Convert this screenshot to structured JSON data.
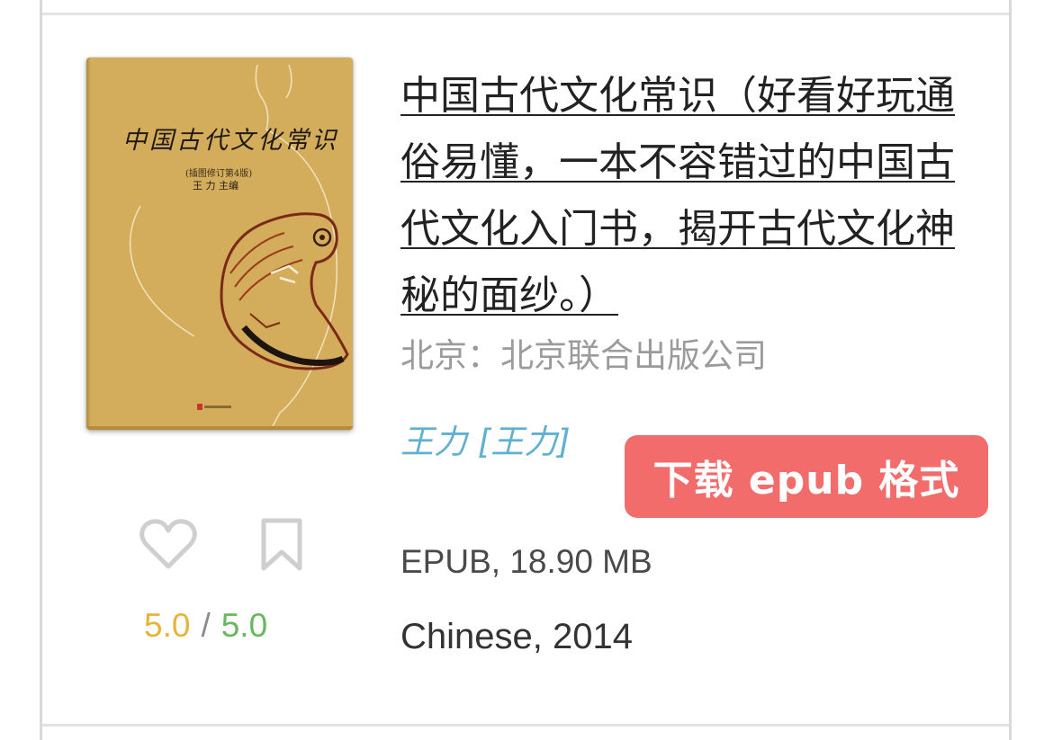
{
  "book": {
    "title": "中国古代文化常识（好看好玩通俗易懂，一本不容错过的中国古代文化入门书，揭开古代文化神秘的面纱。）",
    "publisher": "北京：北京联合出版公司",
    "author": "王力 [王力]",
    "format_size": "EPUB, 18.90 MB",
    "language_year": "Chinese, 2014"
  },
  "cover": {
    "title_text": "中国古代文化常识",
    "subtitle_text": "(插图修订第4版)",
    "editor_text": "王  力  主编",
    "background_color": "#d4ad5c"
  },
  "rating": {
    "user": "5.0",
    "separator": "/",
    "average": "5.0",
    "user_color": "#e8b33b",
    "average_color": "#67b85e"
  },
  "actions": {
    "download_label": "下载 epub 格式",
    "download_color": "#f36c6c",
    "favorite_icon": "heart-icon",
    "bookmark_icon": "bookmark-icon"
  }
}
